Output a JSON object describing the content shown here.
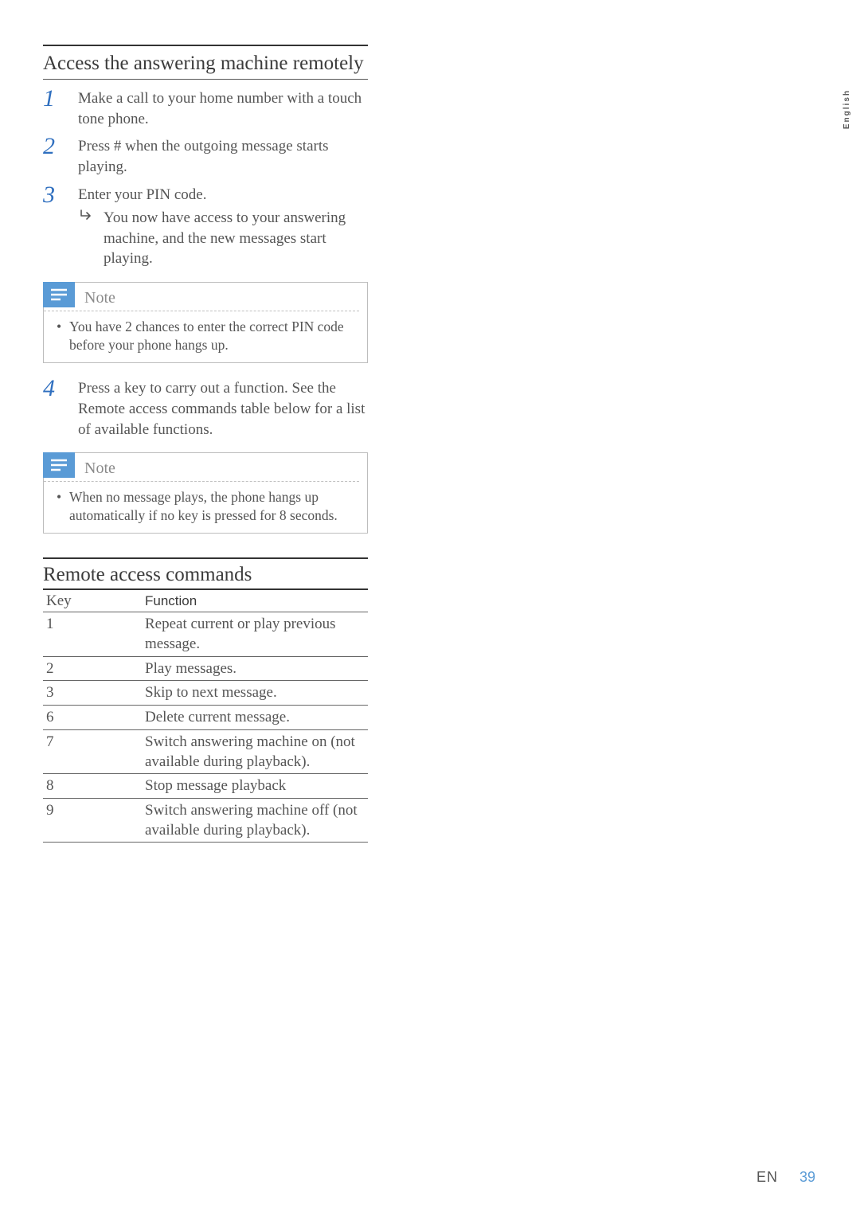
{
  "side_lang": "English",
  "section1": {
    "title": "Access the answering machine remotely",
    "steps": [
      {
        "num": "1",
        "text": "Make a call to your home number with a touch tone phone."
      },
      {
        "num": "2",
        "text": "Press # when the outgoing message starts playing."
      },
      {
        "num": "3",
        "text": "Enter your PIN code.",
        "result": "You now have access to your answering machine, and the new messages start playing."
      },
      {
        "num": "4",
        "text": "Press a key to carry out a function. See the Remote access commands table below for a list of available functions."
      }
    ],
    "note1_label": "Note",
    "note1_text": "You have 2 chances to enter the correct PIN code before your phone hangs up.",
    "note2_label": "Note",
    "note2_text": "When no message plays, the phone hangs up automatically if no key is pressed for 8 seconds."
  },
  "section2": {
    "title": "Remote access commands",
    "key_header": "Key",
    "func_header": "Function"
  },
  "chart_data": {
    "type": "table",
    "title": "Remote access commands",
    "columns": [
      "Key",
      "Function"
    ],
    "rows": [
      {
        "key": "1",
        "function": "Repeat current or play previous message."
      },
      {
        "key": "2",
        "function": "Play messages."
      },
      {
        "key": "3",
        "function": "Skip to next message."
      },
      {
        "key": "6",
        "function": "Delete current message."
      },
      {
        "key": "7",
        "function": "Switch answering machine on (not available during playback)."
      },
      {
        "key": "8",
        "function": "Stop message playback"
      },
      {
        "key": "9",
        "function": "Switch answering machine off (not available during playback)."
      }
    ]
  },
  "footer": {
    "lang": "EN",
    "page": "39"
  }
}
